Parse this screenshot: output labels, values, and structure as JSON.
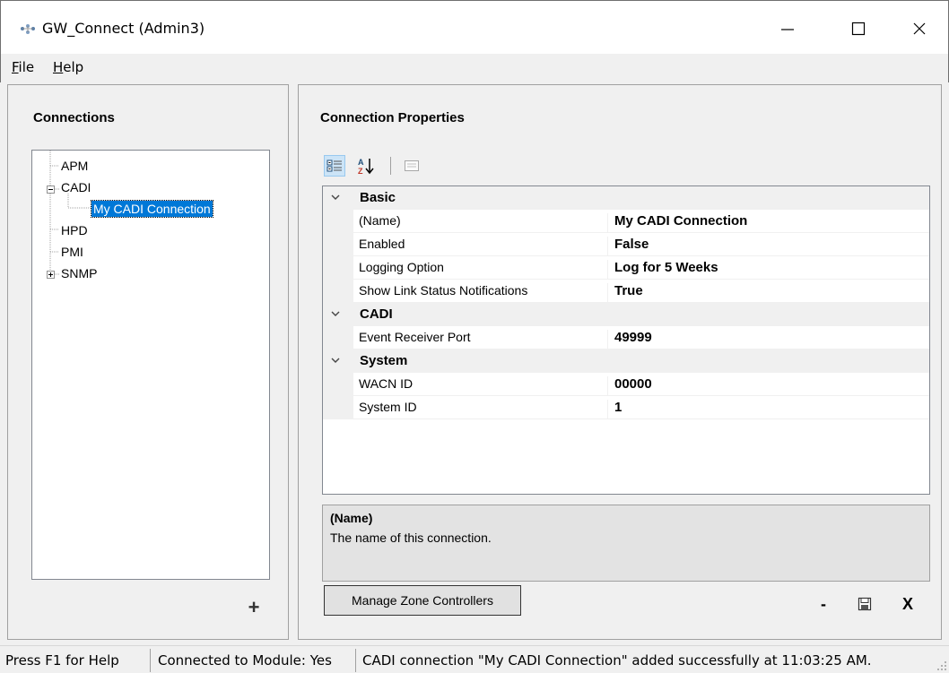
{
  "window": {
    "title": "GW_Connect (Admin3)",
    "icon": "app-network-icon",
    "minimize_glyph": "—",
    "close_glyph": "✕"
  },
  "menu": {
    "file_prefix": "F",
    "file_rest": "ile",
    "help_prefix": "H",
    "help_rest": "elp"
  },
  "connections": {
    "heading": "Connections",
    "tree": [
      {
        "label": "APM",
        "level": 0,
        "expandable": false
      },
      {
        "label": "CADI",
        "level": 0,
        "expandable": true,
        "expanded": true
      },
      {
        "label": "My CADI Connection",
        "level": 1,
        "selected": true
      },
      {
        "label": "HPD",
        "level": 0,
        "expandable": false
      },
      {
        "label": "PMI",
        "level": 0,
        "expandable": false
      },
      {
        "label": "SNMP",
        "level": 0,
        "expandable": true,
        "expanded": false
      }
    ],
    "add_label": "+"
  },
  "properties": {
    "heading": "Connection Properties",
    "categories": [
      {
        "name": "Basic",
        "rows": [
          {
            "name": "(Name)",
            "value": "My CADI Connection"
          },
          {
            "name": "Enabled",
            "value": "False"
          },
          {
            "name": "Logging Option",
            "value": "Log for 5 Weeks"
          },
          {
            "name": "Show Link Status Notifications",
            "value": "True"
          }
        ]
      },
      {
        "name": "CADI",
        "rows": [
          {
            "name": "Event Receiver Port",
            "value": "49999"
          }
        ]
      },
      {
        "name": "System",
        "rows": [
          {
            "name": "WACN ID",
            "value": "00000"
          },
          {
            "name": "System ID",
            "value": "1"
          }
        ]
      }
    ],
    "help": {
      "title": "(Name)",
      "description": "The name of this connection."
    }
  },
  "actions": {
    "manage_zone_controllers": "Manage Zone Controllers",
    "remove_label": "-",
    "delete_label": "X"
  },
  "status": {
    "help": "Press F1 for Help",
    "module": "Connected to Module: Yes",
    "message": "CADI connection \"My CADI Connection\" added successfully at 11:03:25 AM."
  },
  "colors": {
    "selection": "#0078d7",
    "grid_bg": "#ffffff",
    "chrome_bg": "#f0f0f0"
  }
}
